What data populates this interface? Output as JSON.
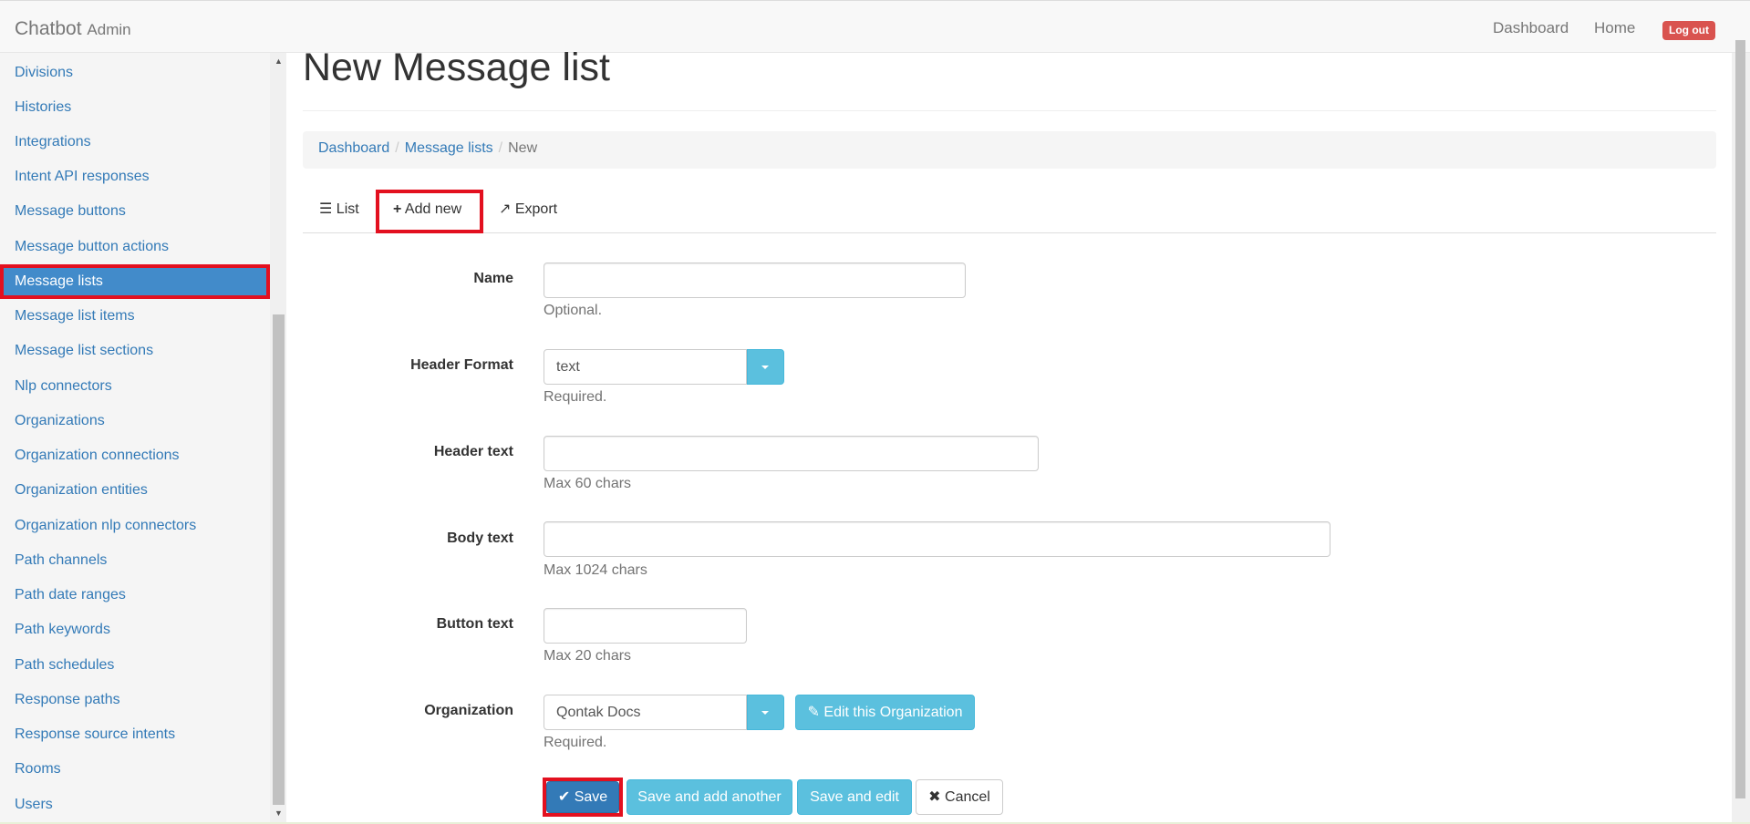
{
  "navbar": {
    "brand": "Chatbot",
    "brand_small": "Admin",
    "links": [
      "Dashboard",
      "Home"
    ],
    "logout": "Log out"
  },
  "sidebar": {
    "items": [
      {
        "label": "Divisions",
        "active": false
      },
      {
        "label": "Histories",
        "active": false
      },
      {
        "label": "Integrations",
        "active": false
      },
      {
        "label": "Intent API responses",
        "active": false
      },
      {
        "label": "Message buttons",
        "active": false
      },
      {
        "label": "Message button actions",
        "active": false
      },
      {
        "label": "Message lists",
        "active": true
      },
      {
        "label": "Message list items",
        "active": false
      },
      {
        "label": "Message list sections",
        "active": false
      },
      {
        "label": "Nlp connectors",
        "active": false
      },
      {
        "label": "Organizations",
        "active": false
      },
      {
        "label": "Organization connections",
        "active": false
      },
      {
        "label": "Organization entities",
        "active": false
      },
      {
        "label": "Organization nlp connectors",
        "active": false
      },
      {
        "label": "Path channels",
        "active": false
      },
      {
        "label": "Path date ranges",
        "active": false
      },
      {
        "label": "Path keywords",
        "active": false
      },
      {
        "label": "Path schedules",
        "active": false
      },
      {
        "label": "Response paths",
        "active": false
      },
      {
        "label": "Response source intents",
        "active": false
      },
      {
        "label": "Rooms",
        "active": false
      },
      {
        "label": "Users",
        "active": false
      }
    ]
  },
  "page": {
    "title": "New Message list",
    "breadcrumb": [
      "Dashboard",
      "Message lists",
      "New"
    ],
    "tabs": {
      "list": "List",
      "add_new": "Add new",
      "export": "Export"
    }
  },
  "form": {
    "name": {
      "label": "Name",
      "value": "",
      "help": "Optional."
    },
    "header_format": {
      "label": "Header Format",
      "value": "text",
      "help": "Required."
    },
    "header_text": {
      "label": "Header text",
      "value": "",
      "help": "Max 60 chars"
    },
    "body_text": {
      "label": "Body text",
      "value": "",
      "help": "Max 1024 chars"
    },
    "button_text": {
      "label": "Button text",
      "value": "",
      "help": "Max 20 chars"
    },
    "organization": {
      "label": "Organization",
      "value": "Qontak Docs",
      "help": "Required.",
      "edit_button": "Edit this Organization"
    }
  },
  "actions": {
    "save": "Save",
    "save_add_another": "Save and add another",
    "save_edit": "Save and edit",
    "cancel": "Cancel"
  },
  "colors": {
    "primary": "#337ab7",
    "info": "#5bc0de",
    "danger": "#d9534f",
    "highlight": "#e3101f"
  }
}
